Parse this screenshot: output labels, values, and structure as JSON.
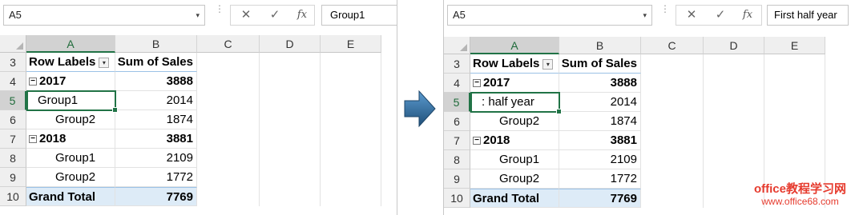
{
  "left": {
    "name_box": "A5",
    "formula_value": "Group1",
    "columns": [
      "A",
      "B",
      "C",
      "D",
      "E"
    ],
    "row_numbers": [
      "3",
      "4",
      "5",
      "6",
      "7",
      "8",
      "9",
      "10"
    ],
    "pivot": {
      "header_labels": "Row Labels",
      "header_sum": "Sum of Sales",
      "rows": [
        {
          "label": "2017",
          "value": "3888"
        },
        {
          "label": "Group1",
          "value": "2014"
        },
        {
          "label": "Group2",
          "value": "1874"
        },
        {
          "label": "2018",
          "value": "3881"
        },
        {
          "label": "Group1",
          "value": "2109"
        },
        {
          "label": "Group2",
          "value": "1772"
        }
      ],
      "grand_total_label": "Grand Total",
      "grand_total_value": "7769"
    }
  },
  "right": {
    "name_box": "A5",
    "formula_value": "First half year",
    "columns": [
      "A",
      "B",
      "C",
      "D",
      "E"
    ],
    "row_numbers": [
      "3",
      "4",
      "5",
      "6",
      "7",
      "8",
      "9",
      "10"
    ],
    "pivot": {
      "header_labels": "Row Labels",
      "header_sum": "Sum of Sales",
      "rows": [
        {
          "label": "2017",
          "value": "3888"
        },
        {
          "label": ": half year",
          "value": "2014"
        },
        {
          "label": "Group2",
          "value": "1874"
        },
        {
          "label": "2018",
          "value": "3881"
        },
        {
          "label": "Group1",
          "value": "2109"
        },
        {
          "label": "Group2",
          "value": "1772"
        }
      ],
      "grand_total_label": "Grand Total",
      "grand_total_value": "7769"
    }
  },
  "toolbar": {
    "cancel_glyph": "✕",
    "enter_glyph": "✓",
    "fx_label": "fx",
    "dots": "⋮"
  },
  "icons": {
    "dropdown": "▾",
    "collapse": "−",
    "filter": "▾"
  },
  "watermark": {
    "line1": "office教程学习网",
    "line2": "www.office68.com"
  },
  "colors": {
    "accent": "#217346",
    "pivot_header_line": "#9bc2e6",
    "grand_total_fill": "#ddebf7",
    "arrow": "#2e6d99",
    "watermark": "#e63b2e"
  }
}
